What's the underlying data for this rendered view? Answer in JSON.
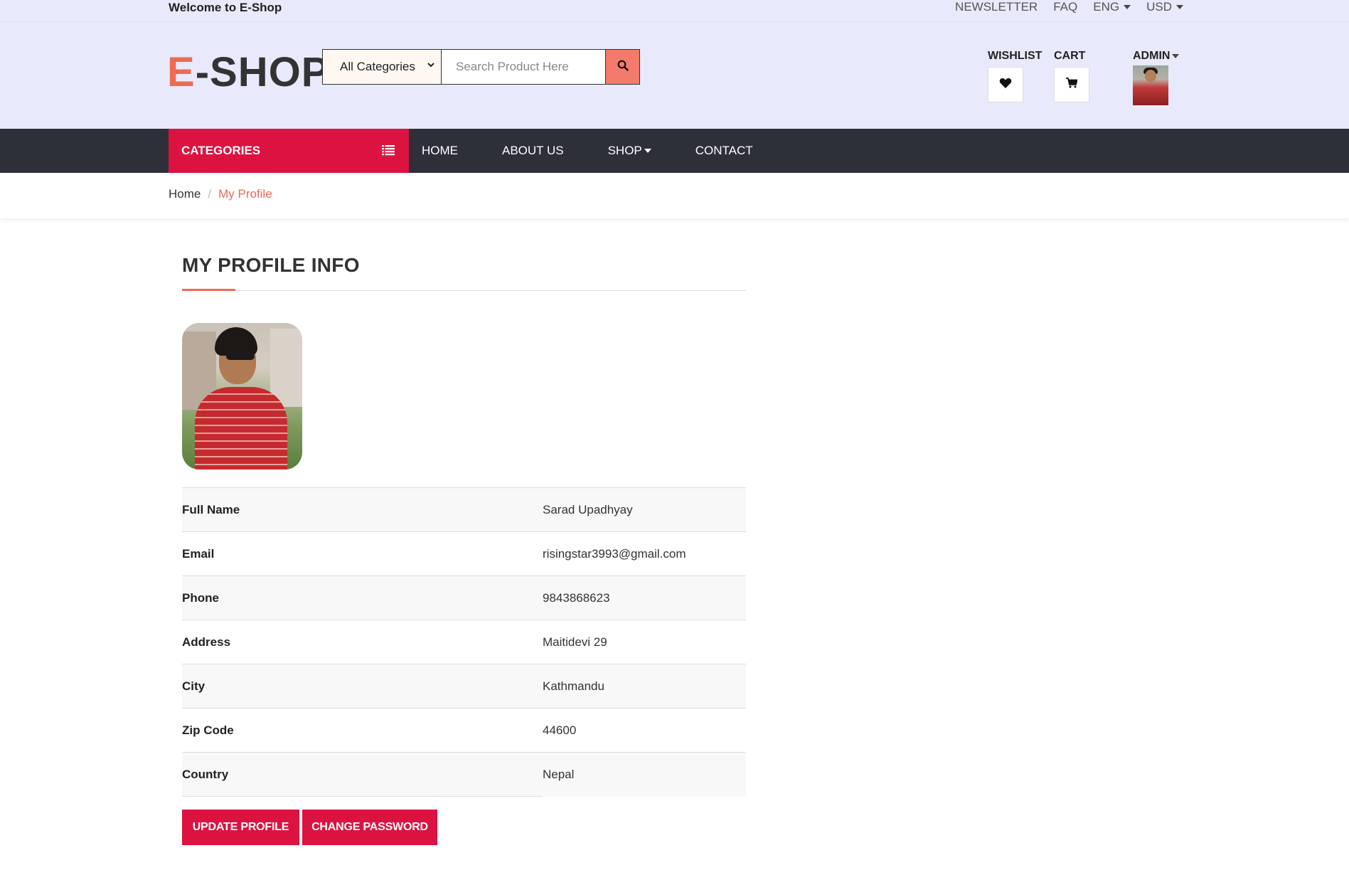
{
  "topbar": {
    "welcome": "Welcome to E-Shop",
    "newsletter": "NEWSLETTER",
    "faq": "FAQ",
    "language": "ENG",
    "currency": "USD"
  },
  "header": {
    "logo_first": "E",
    "logo_rest": "-SHOP",
    "category_select": "All Categories",
    "search_placeholder": "Search Product Here",
    "wishlist_label": "WISHLIST",
    "cart_label": "CART",
    "admin_label": "ADMIN"
  },
  "nav": {
    "categories": "CATEGORIES",
    "items": [
      "HOME",
      "ABOUT US",
      "SHOP",
      "CONTACT"
    ]
  },
  "breadcrumb": {
    "home": "Home",
    "separator": "/",
    "current": "My Profile"
  },
  "profile": {
    "title": "MY PROFILE INFO",
    "rows": [
      {
        "label": "Full Name",
        "value": "Sarad Upadhyay"
      },
      {
        "label": "Email",
        "value": "risingstar3993@gmail.com"
      },
      {
        "label": "Phone",
        "value": "9843868623"
      },
      {
        "label": "Address",
        "value": "Maitidevi 29"
      },
      {
        "label": "City",
        "value": "Kathmandu"
      },
      {
        "label": "Zip Code",
        "value": "44600"
      },
      {
        "label": "Country",
        "value": "Nepal"
      }
    ],
    "update_button": "UPDATE PROFILE",
    "password_button": "CHANGE PASSWORD"
  },
  "colors": {
    "accent": "#dc1340",
    "logo_accent": "#ef6a53",
    "header_bg": "#e8e9fb",
    "nav_bg": "#2e3039"
  },
  "icons": [
    "search-icon",
    "heart-icon",
    "cart-icon",
    "list-icon",
    "chevron-down-icon",
    "caret-down-icon"
  ]
}
